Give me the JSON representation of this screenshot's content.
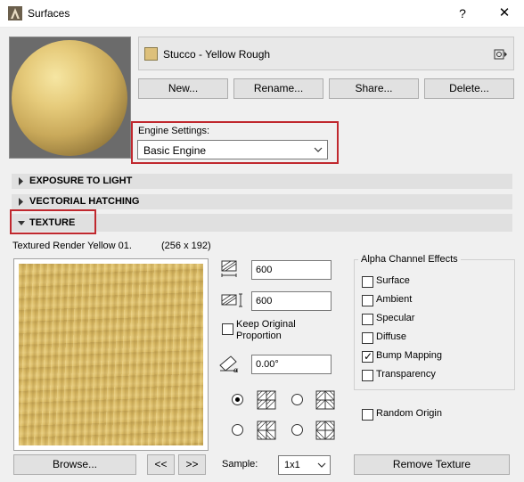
{
  "window": {
    "title": "Surfaces",
    "help_label": "?",
    "close_label": "✕"
  },
  "surface": {
    "name": "Stucco - Yellow Rough",
    "swatch_color": "#ddc07b"
  },
  "buttons": {
    "new": "New...",
    "rename": "Rename...",
    "share": "Share...",
    "delete": "Delete..."
  },
  "engine": {
    "label": "Engine Settings:",
    "value": "Basic Engine"
  },
  "sections": [
    {
      "label": "EXPOSURE TO LIGHT",
      "expanded": false
    },
    {
      "label": "VECTORIAL HATCHING",
      "expanded": false
    },
    {
      "label": "TEXTURE",
      "expanded": true
    }
  ],
  "texture": {
    "name": "Textured Render Yellow 01.",
    "size": "(256 x 192)",
    "width": "600",
    "height": "600",
    "keep_proportion_line1": "Keep Original",
    "keep_proportion_line2": "Proportion",
    "keep_proportion_checked": false,
    "angle": "0.00°",
    "browse": "Browse...",
    "prev": "<<",
    "next": ">>",
    "sample_label": "Sample:",
    "sample_value": "1x1",
    "remove": "Remove Texture",
    "mirror_option_selected": 0
  },
  "alpha": {
    "title": "Alpha Channel Effects",
    "items": [
      {
        "label": "Surface",
        "checked": false
      },
      {
        "label": "Ambient",
        "checked": false
      },
      {
        "label": "Specular",
        "checked": false
      },
      {
        "label": "Diffuse",
        "checked": false
      },
      {
        "label": "Bump Mapping",
        "checked": true
      },
      {
        "label": "Transparency",
        "checked": false
      }
    ],
    "random_origin": "Random Origin",
    "random_origin_checked": false
  },
  "colors": {
    "highlight": "#c0282e",
    "texture_base": "#d8b862"
  }
}
